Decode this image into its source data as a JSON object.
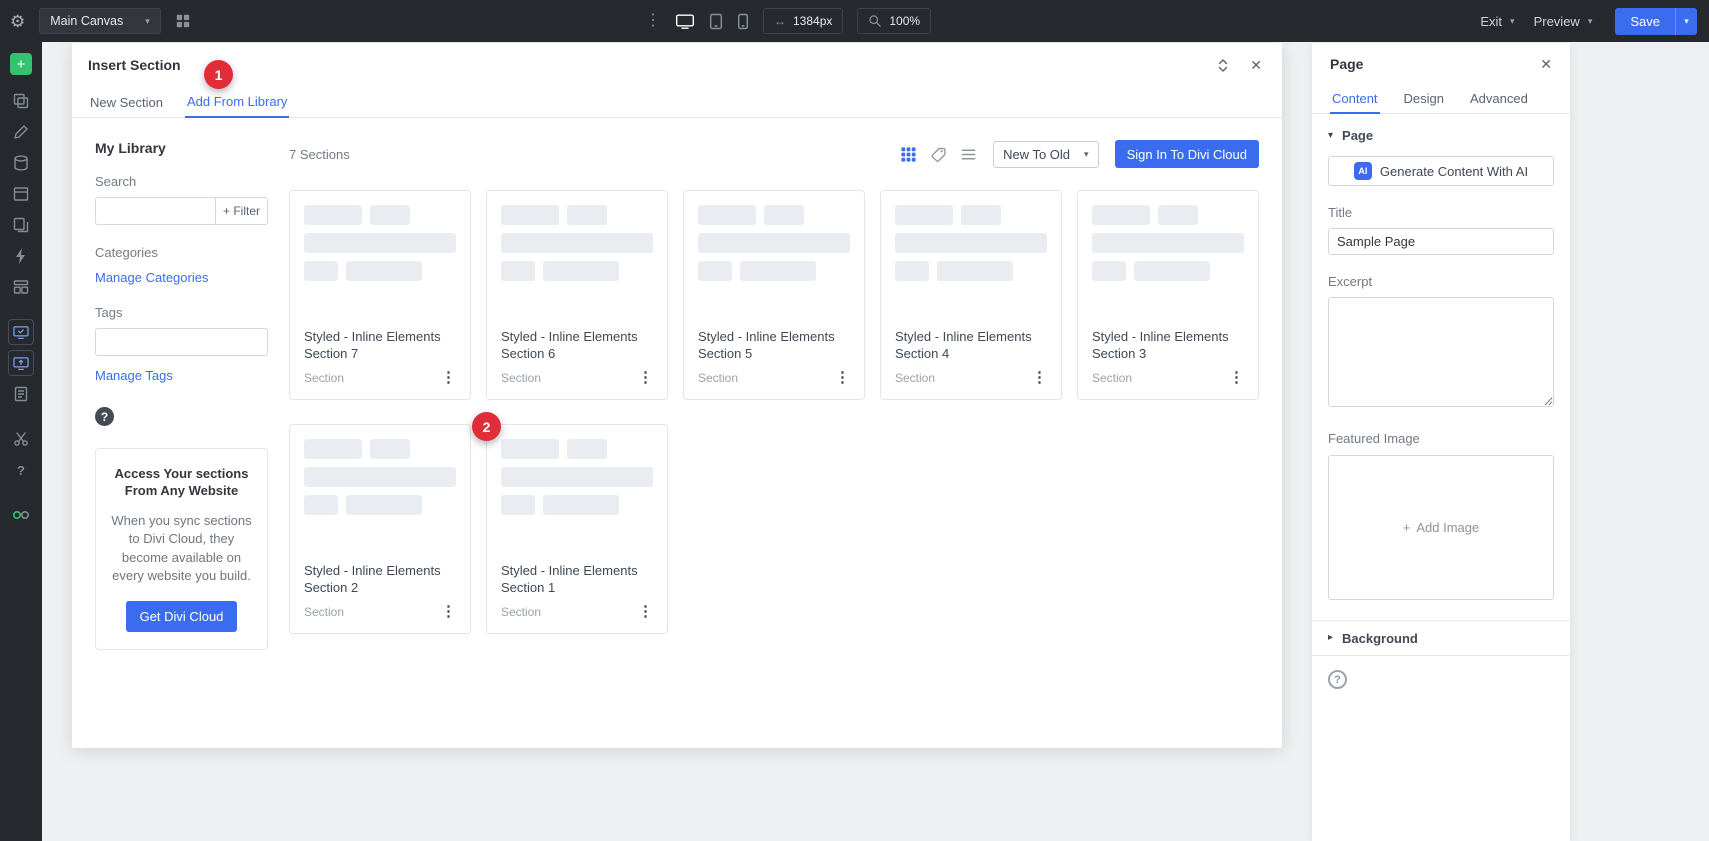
{
  "colors": {
    "accent": "#3b6cf0",
    "badge": "#e12d39",
    "toolbar": "#26292d",
    "canvas": "#eef0f2",
    "green": "#36c16e",
    "border": "#e3e6ea",
    "input_border": "#d3d8de",
    "dark": "#33373d",
    "gray": "#747b85",
    "icon": "#868d95",
    "skel": "#e9edf2"
  },
  "icons": {
    "gear": "⚙",
    "dots_v": "⋮",
    "close": "✕",
    "chevron_down": "▾",
    "caret_right": "▸",
    "help": "?",
    "plus": "+",
    "arrows_h": "↔"
  },
  "toolbar": {
    "canvas_select_label": "Main Canvas",
    "width_value": "1384px",
    "zoom_value": "100%",
    "exit_label": "Exit",
    "preview_label": "Preview",
    "save_label": "Save"
  },
  "modal": {
    "title": "Insert Section",
    "tabs": {
      "new_section": "New Section",
      "add_from_library": "Add From Library"
    },
    "badges": {
      "step1": "1",
      "step2": "2"
    },
    "sidebar": {
      "title": "My Library",
      "search_label": "Search",
      "filter_button": "+ Filter",
      "categories_label": "Categories",
      "manage_categories_link": "Manage Categories",
      "tags_label": "Tags",
      "manage_tags_link": "Manage Tags",
      "promo_title": "Access Your sections From Any Website",
      "promo_body": "When you sync sections to Divi Cloud, they become available on every website you build.",
      "promo_button": "Get Divi Cloud"
    },
    "content": {
      "count": "7 Sections",
      "sort_value": "New To Old",
      "sign_in_button": "Sign In To Divi Cloud",
      "cards": [
        {
          "title": "Styled - Inline Elements Section 7",
          "type": "Section"
        },
        {
          "title": "Styled - Inline Elements Section 6",
          "type": "Section"
        },
        {
          "title": "Styled - Inline Elements Section 5",
          "type": "Section"
        },
        {
          "title": "Styled - Inline Elements Section 4",
          "type": "Section"
        },
        {
          "title": "Styled - Inline Elements Section 3",
          "type": "Section"
        },
        {
          "title": "Styled - Inline Elements Section 2",
          "type": "Section"
        },
        {
          "title": "Styled - Inline Elements Section 1",
          "type": "Section"
        }
      ]
    }
  },
  "settings_panel": {
    "title": "Page",
    "tabs": {
      "content": "Content",
      "design": "Design",
      "advanced": "Advanced"
    },
    "page_toggle_label": "Page",
    "ai_icon_text": "AI",
    "ai_button_label": "Generate Content With AI",
    "title_label": "Title",
    "title_value": "Sample Page",
    "excerpt_label": "Excerpt",
    "featured_image_label": "Featured Image",
    "add_image_label": "Add Image",
    "background_label": "Background"
  }
}
